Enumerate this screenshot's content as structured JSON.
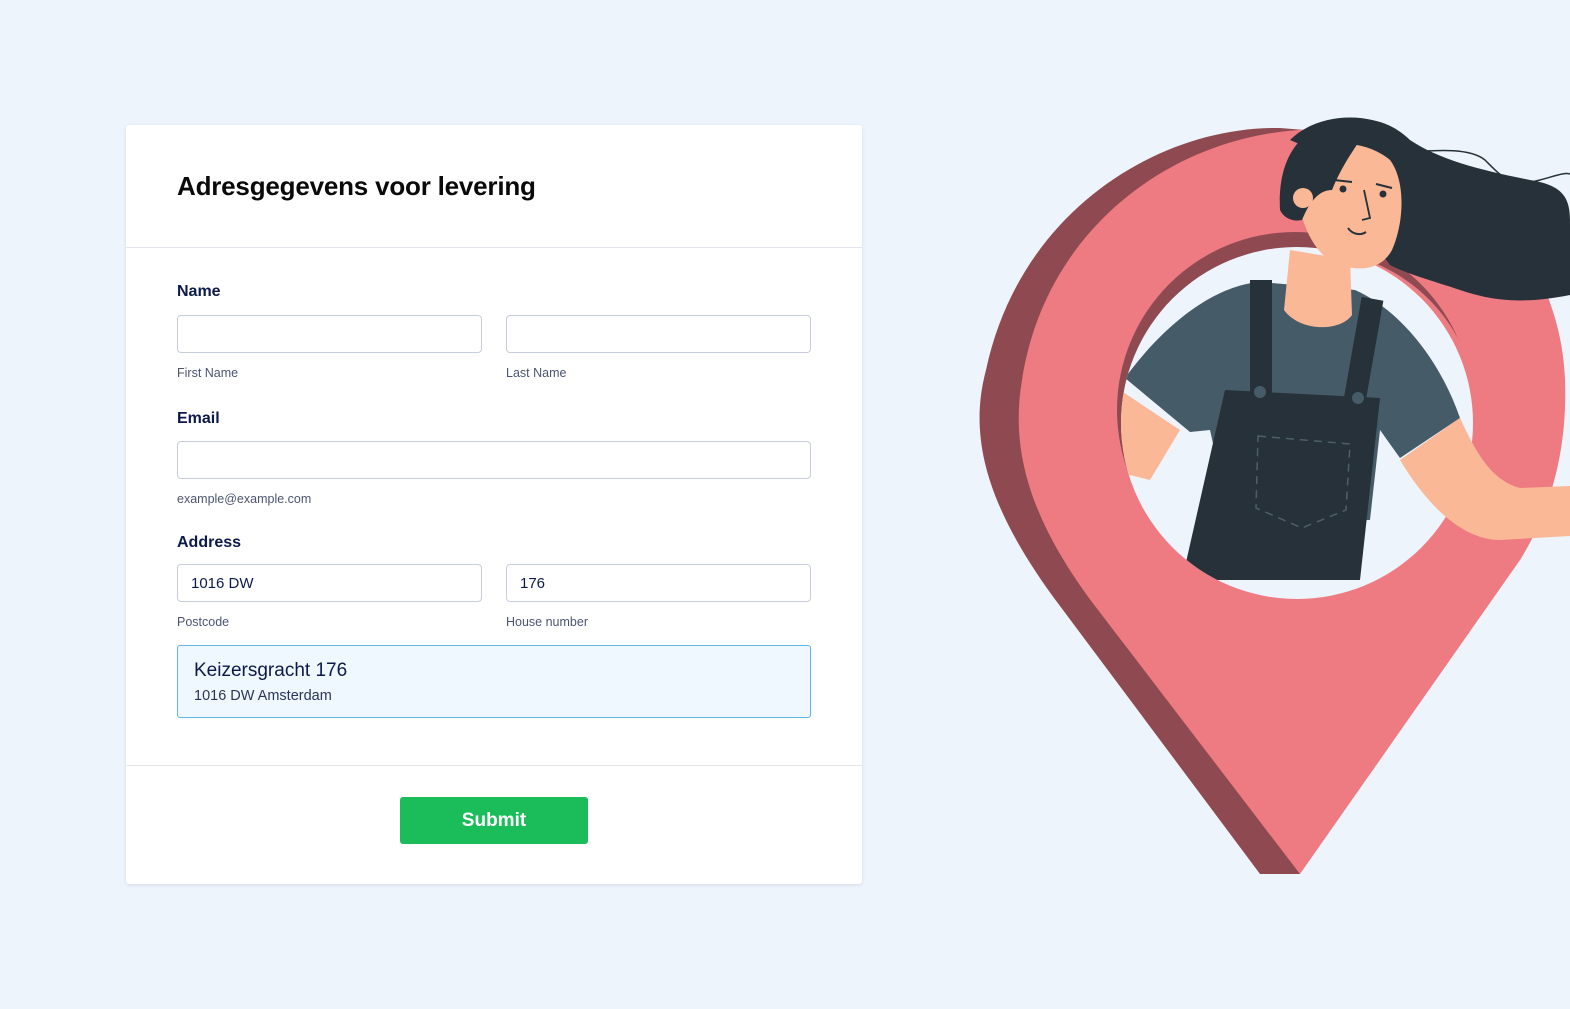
{
  "form": {
    "title": "Adresgegevens voor levering",
    "name": {
      "label": "Name",
      "first_value": "",
      "first_sublabel": "First Name",
      "last_value": "",
      "last_sublabel": "Last Name"
    },
    "email": {
      "label": "Email",
      "value": "",
      "sublabel": "example@example.com"
    },
    "address": {
      "label": "Address",
      "postcode_value": "1016 DW",
      "postcode_sublabel": "Postcode",
      "house_number_value": "176",
      "house_number_sublabel": "House number",
      "result": {
        "street": "Keizersgracht 176",
        "city_line": "1016 DW Amsterdam"
      }
    },
    "submit_label": "Submit"
  },
  "colors": {
    "page_background": "#edf4fb",
    "submit_button": "#1bbc5a",
    "pin_front": "#ee7a82",
    "pin_side": "#8f4a51",
    "address_highlight_border": "#5fb6ea",
    "address_highlight_fill": "#eef8fe"
  },
  "illustration": {
    "subject": "woman-in-overalls-inside-location-pin"
  }
}
